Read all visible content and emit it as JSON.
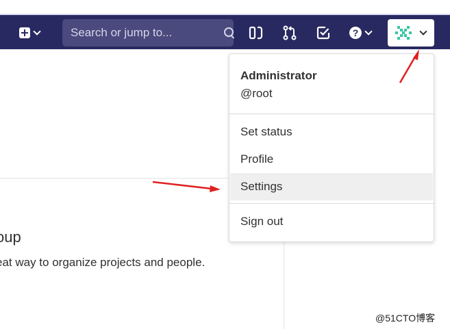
{
  "navbar": {
    "search": {
      "placeholder": "Search or jump to..."
    },
    "icons": [
      "plus-square-icon",
      "chevron-down-icon",
      "search-icon",
      "issues-icon",
      "merge-request-icon",
      "todo-check-icon",
      "help-icon",
      "user-avatar-icon"
    ],
    "background_color": "#292961",
    "search_bg_color": "#4a4a7e"
  },
  "dropdown": {
    "user_name": "Administrator",
    "user_handle": "@root",
    "items": [
      {
        "label": "Set status"
      },
      {
        "label": "Profile"
      },
      {
        "label": "Settings"
      },
      {
        "label": "Sign out"
      }
    ],
    "highlighted_item": "Settings"
  },
  "main": {
    "heading": "oup",
    "description": "eat way to organize projects and people."
  },
  "annotations": {
    "arrow_color": "#e02020"
  },
  "watermark": "@51CTO博客"
}
